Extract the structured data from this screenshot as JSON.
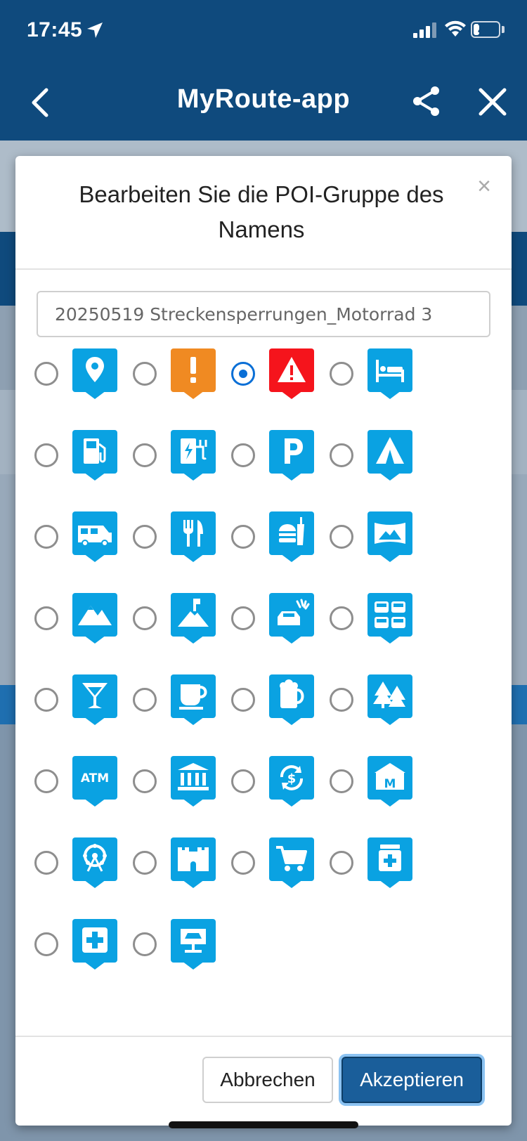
{
  "status_bar": {
    "time": "17:45",
    "battery": "24",
    "battery_level": 0.24
  },
  "header": {
    "title": "MyRoute-app"
  },
  "modal": {
    "title": "Bearbeiten Sie die POI-Gruppe des Namens",
    "close_symbol": "×",
    "name_value": "20250519 Streckensperrungen_Motorrad 3",
    "selected_icon": "warning-triangle",
    "icons": [
      [
        "map-marker",
        "exclamation",
        "warning-triangle",
        "hotel-bed"
      ],
      [
        "fuel-pump",
        "ev-charger",
        "parking",
        "camping-tent"
      ],
      [
        "camper-van",
        "restaurant",
        "fast-food",
        "panorama-view"
      ],
      [
        "mountains",
        "mountain-pass",
        "car-wash",
        "car-park"
      ],
      [
        "cocktail-bar",
        "coffee-cup",
        "beer-mug",
        "forest"
      ],
      [
        "atm",
        "bank",
        "currency-exchange",
        "museum"
      ],
      [
        "ferris-wheel",
        "castle",
        "shopping-cart",
        "pharmacy"
      ],
      [
        "hospital",
        "car-service"
      ]
    ],
    "colors": {
      "default": "#0aa2e2",
      "exclamation": "#f08a22",
      "warning": "#f5141c",
      "selected_radio": "#0a6fd6"
    },
    "cancel_label": "Abbrechen",
    "accept_label": "Akzeptieren"
  }
}
